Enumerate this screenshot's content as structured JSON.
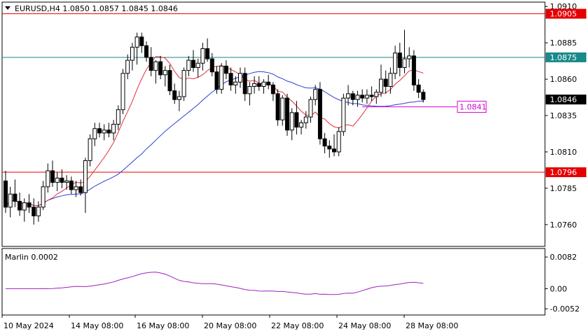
{
  "chart_data": {
    "type": "candlestick",
    "symbol_label": "EURUSD,H4",
    "ohlc_label": {
      "open": "1.0850",
      "high": "1.0857",
      "low": "1.0845",
      "close": "1.0846"
    },
    "price_axis": {
      "range": [
        1.0745,
        1.0913
      ],
      "ticks": [
        "1.0910",
        "1.0885",
        "1.0860",
        "1.0835",
        "1.0810",
        "1.0785",
        "1.0760"
      ]
    },
    "x_axis": {
      "tick_labels": [
        "10 May 2024",
        "14 May 08:00",
        "16 May 08:00",
        "20 May 08:00",
        "22 May 08:00",
        "24 May 08:00",
        "28 May 08:00"
      ]
    },
    "levels": [
      {
        "label": "1.0905",
        "value": 1.0905,
        "color": "#e60000"
      },
      {
        "label": "1.0875",
        "value": 1.0875,
        "color": "#1a8a8a"
      },
      {
        "label": "1.0796",
        "value": 1.0796,
        "color": "#e60000"
      }
    ],
    "current_price": {
      "label": "1.0846",
      "value": 1.0846
    },
    "annotation": {
      "label": "1.0841",
      "value": 1.0841,
      "color": "#d400d4"
    },
    "candles": [
      [
        1.079,
        1.0797,
        1.0768,
        1.0772
      ],
      [
        1.0772,
        1.0786,
        1.0765,
        1.0781
      ],
      [
        1.0781,
        1.0791,
        1.0772,
        1.0776
      ],
      [
        1.0776,
        1.0782,
        1.0766,
        1.077
      ],
      [
        1.077,
        1.0778,
        1.0762,
        1.0775
      ],
      [
        1.0775,
        1.0781,
        1.0768,
        1.0772
      ],
      [
        1.0772,
        1.0778,
        1.076,
        1.0766
      ],
      [
        1.0766,
        1.0776,
        1.0762,
        1.0772
      ],
      [
        1.0772,
        1.079,
        1.077,
        1.0786
      ],
      [
        1.0786,
        1.0802,
        1.0782,
        1.0797
      ],
      [
        1.0797,
        1.0804,
        1.0786,
        1.0789
      ],
      [
        1.0789,
        1.0796,
        1.0783,
        1.0792
      ],
      [
        1.0792,
        1.0798,
        1.0785,
        1.0789
      ],
      [
        1.0789,
        1.0794,
        1.0784,
        1.079
      ],
      [
        1.079,
        1.0793,
        1.0781,
        1.0784
      ],
      [
        1.0784,
        1.079,
        1.0779,
        1.0786
      ],
      [
        1.0786,
        1.0791,
        1.078,
        1.0782
      ],
      [
        1.0782,
        1.0806,
        1.0768,
        1.0804
      ],
      [
        1.0804,
        1.0822,
        1.08,
        1.0819
      ],
      [
        1.0819,
        1.083,
        1.0814,
        1.0826
      ],
      [
        1.0826,
        1.083,
        1.082,
        1.0823
      ],
      [
        1.0823,
        1.0829,
        1.0818,
        1.0825
      ],
      [
        1.0825,
        1.083,
        1.082,
        1.0823
      ],
      [
        1.0823,
        1.0832,
        1.0818,
        1.0829
      ],
      [
        1.0829,
        1.0842,
        1.0825,
        1.0839
      ],
      [
        1.0839,
        1.0867,
        1.0836,
        1.0864
      ],
      [
        1.0864,
        1.0877,
        1.086,
        1.0873
      ],
      [
        1.0873,
        1.0885,
        1.0866,
        1.0882
      ],
      [
        1.0882,
        1.0892,
        1.087,
        1.0889
      ],
      [
        1.0889,
        1.0892,
        1.0878,
        1.0883
      ],
      [
        1.0883,
        1.0886,
        1.0872,
        1.0875
      ],
      [
        1.0875,
        1.0882,
        1.0862,
        1.0866
      ],
      [
        1.0866,
        1.0873,
        1.0857,
        1.0872
      ],
      [
        1.0872,
        1.0876,
        1.086,
        1.0863
      ],
      [
        1.0863,
        1.0869,
        1.0855,
        1.0866
      ],
      [
        1.0866,
        1.087,
        1.0849,
        1.0852
      ],
      [
        1.0852,
        1.0857,
        1.0843,
        1.0846
      ],
      [
        1.0846,
        1.0852,
        1.0838,
        1.0848
      ],
      [
        1.0848,
        1.0868,
        1.0845,
        1.0866
      ],
      [
        1.0866,
        1.0876,
        1.0862,
        1.0873
      ],
      [
        1.0873,
        1.088,
        1.0865,
        1.0868
      ],
      [
        1.0868,
        1.0874,
        1.0861,
        1.0871
      ],
      [
        1.0871,
        1.0885,
        1.0866,
        1.0881
      ],
      [
        1.0881,
        1.0888,
        1.0872,
        1.0874
      ],
      [
        1.0874,
        1.0878,
        1.0862,
        1.0865
      ],
      [
        1.0865,
        1.0869,
        1.085,
        1.0853
      ],
      [
        1.0853,
        1.0871,
        1.085,
        1.0869
      ],
      [
        1.0869,
        1.0873,
        1.086,
        1.0864
      ],
      [
        1.0864,
        1.0868,
        1.0852,
        1.0856
      ],
      [
        1.0856,
        1.0862,
        1.085,
        1.0858
      ],
      [
        1.0858,
        1.0868,
        1.0854,
        1.0864
      ],
      [
        1.0864,
        1.0868,
        1.0845,
        1.085
      ],
      [
        1.085,
        1.0858,
        1.0842,
        1.0855
      ],
      [
        1.0855,
        1.0862,
        1.085,
        1.0857
      ],
      [
        1.0857,
        1.0862,
        1.0852,
        1.0855
      ],
      [
        1.0855,
        1.086,
        1.085,
        1.0858
      ],
      [
        1.0858,
        1.0863,
        1.0853,
        1.0856
      ],
      [
        1.0856,
        1.0858,
        1.0845,
        1.085
      ],
      [
        1.085,
        1.0853,
        1.0828,
        1.0832
      ],
      [
        1.0832,
        1.0849,
        1.0828,
        1.0847
      ],
      [
        1.0847,
        1.085,
        1.0821,
        1.0825
      ],
      [
        1.0825,
        1.084,
        1.0818,
        1.0837
      ],
      [
        1.0837,
        1.0845,
        1.0822,
        1.0827
      ],
      [
        1.0827,
        1.0832,
        1.0822,
        1.083
      ],
      [
        1.083,
        1.0838,
        1.0826,
        1.0834
      ],
      [
        1.0834,
        1.0848,
        1.083,
        1.0846
      ],
      [
        1.0846,
        1.0856,
        1.0842,
        1.0853
      ],
      [
        1.0853,
        1.0858,
        1.0815,
        1.0819
      ],
      [
        1.0819,
        1.0823,
        1.0809,
        1.0814
      ],
      [
        1.0814,
        1.0818,
        1.0806,
        1.0812
      ],
      [
        1.0812,
        1.0822,
        1.0807,
        1.081
      ],
      [
        1.081,
        1.0827,
        1.0807,
        1.0824
      ],
      [
        1.0824,
        1.085,
        1.0821,
        1.0847
      ],
      [
        1.0847,
        1.0856,
        1.0842,
        1.085
      ],
      [
        1.085,
        1.0852,
        1.0842,
        1.0846
      ],
      [
        1.0846,
        1.0852,
        1.0841,
        1.0849
      ],
      [
        1.0849,
        1.0853,
        1.0844,
        1.0847
      ],
      [
        1.0847,
        1.0853,
        1.0843,
        1.0849
      ],
      [
        1.0849,
        1.0855,
        1.0845,
        1.0848
      ],
      [
        1.0848,
        1.0853,
        1.0843,
        1.0851
      ],
      [
        1.0851,
        1.087,
        1.0848,
        1.086
      ],
      [
        1.086,
        1.0866,
        1.085,
        1.0855
      ],
      [
        1.0855,
        1.0868,
        1.085,
        1.0864
      ],
      [
        1.0864,
        1.0883,
        1.086,
        1.0878
      ],
      [
        1.0878,
        1.0885,
        1.0862,
        1.0868
      ],
      [
        1.0868,
        1.0894,
        1.0864,
        1.0874
      ],
      [
        1.0874,
        1.0882,
        1.0868,
        1.0876
      ],
      [
        1.0876,
        1.088,
        1.0852,
        1.0856
      ],
      [
        1.0856,
        1.086,
        1.0847,
        1.0851
      ],
      [
        1.0851,
        1.0853,
        1.0844,
        1.0846
      ]
    ],
    "ma_fast_color": "#e0303a",
    "ma_slow_color": "#2d3fd6",
    "indicator": {
      "label": "Marlin 0.0002",
      "ticks": [
        "0.0082",
        "0.00",
        "-0.0052"
      ],
      "range": [
        -0.0068,
        0.0104
      ],
      "color": "#a020c0"
    }
  }
}
